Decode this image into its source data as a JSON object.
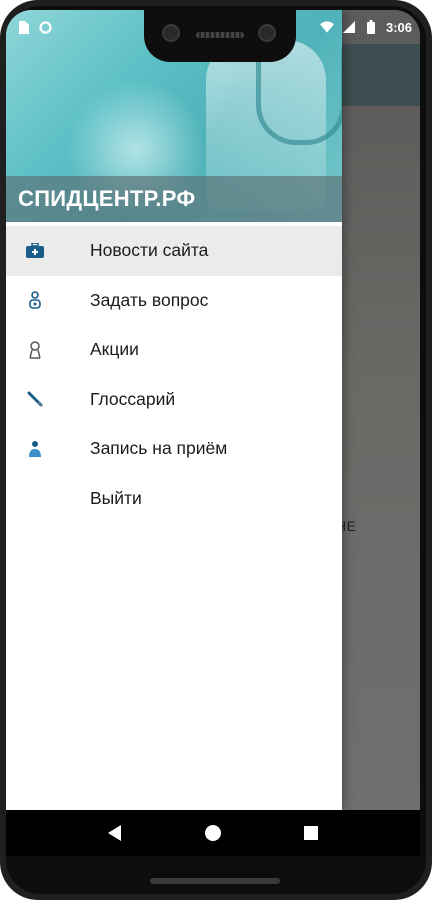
{
  "status_bar": {
    "time": "3:06",
    "left_icons": [
      "sim-icon",
      "sync-icon"
    ],
    "right_icons": [
      "wifi-icon",
      "signal-icon",
      "battery-icon"
    ]
  },
  "background_app": {
    "peek_text": "НЕ"
  },
  "drawer": {
    "title": "СПИДЦЕНТР.РФ",
    "items": [
      {
        "label": "Новости сайта",
        "icon": "medkit-icon",
        "active": true
      },
      {
        "label": "Задать вопрос",
        "icon": "question-icon",
        "active": false
      },
      {
        "label": "Акции",
        "icon": "ribbon-icon",
        "active": false
      },
      {
        "label": "Глоссарий",
        "icon": "syringe-icon",
        "active": false
      },
      {
        "label": "Запись на приём",
        "icon": "doctor-icon",
        "active": false
      },
      {
        "label": "Выйти",
        "icon": "",
        "active": false
      }
    ]
  },
  "nav_bar": {
    "buttons": [
      "back-icon",
      "home-icon",
      "recents-icon"
    ]
  },
  "colors": {
    "accent": "#1a5c8a",
    "header_teal": "#5cc0c6",
    "active_row": "#ebebeb"
  }
}
